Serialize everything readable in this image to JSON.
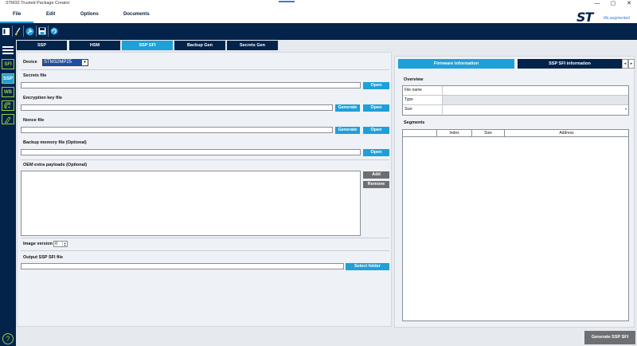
{
  "window": {
    "title": "STM32 Trusted Package Creator",
    "controls": [
      "—",
      "▢",
      "✕"
    ]
  },
  "menu": {
    "items": [
      "File",
      "Edit",
      "Options",
      "Documents"
    ]
  },
  "logo": {
    "brand": "ST",
    "tagline": "life.augmented"
  },
  "toolbar": {
    "icons": [
      "sidebar-toggle-icon",
      "brush-icon",
      "wrench-icon",
      "save-icon",
      "refresh-icon"
    ]
  },
  "sidebar": {
    "items": [
      "SFI",
      "SSP",
      "WB",
      "icon-a",
      "icon-b"
    ],
    "active": "SSP"
  },
  "tabs": {
    "items": [
      "SSP",
      "HSM",
      "SSP SFI",
      "Backup Gen",
      "Secrets Gen"
    ],
    "active": "SSP SFI"
  },
  "form": {
    "device_label": "Device",
    "device_value": "STM32MP25",
    "secrets_file_label": "Secrets file",
    "encryption_key_label": "Encryption key file",
    "nonce_file_label": "Nonce file",
    "backup_memory_label": "Backup memory file (Optional)",
    "oem_payloads_label": "OEM extra payloads (Optional)",
    "image_version_label": "Image version",
    "image_version_value": "0",
    "output_label": "Output SSP SFI file",
    "open_label": "Open",
    "generate_label": "Generate",
    "add_label": "Add",
    "remove_label": "Remove",
    "select_folder_label": "Select folder"
  },
  "right_panel": {
    "tabs": [
      "Firmware information",
      "SSP SFI information"
    ],
    "active_tab": "Firmware information",
    "overview_title": "Overview",
    "overview_rows": [
      "File name",
      "Type",
      "Size"
    ],
    "segments_title": "Segments",
    "segments_columns": [
      "Index",
      "Size",
      "Address"
    ]
  },
  "footer": {
    "generate_button": "Generate SSP SFI"
  },
  "colors": {
    "navy": "#03234b",
    "accent_blue": "#1ea0d9",
    "green": "#9ccd3a",
    "gray_button": "#6d6f73"
  }
}
